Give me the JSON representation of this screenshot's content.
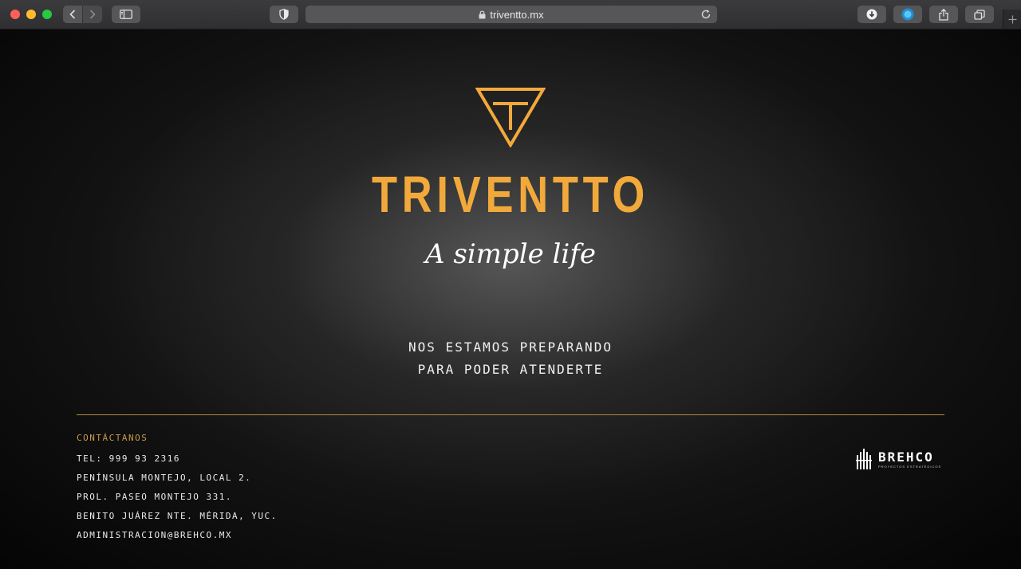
{
  "browser": {
    "url": "triventto.mx",
    "icons": [
      "back-chevron-icon",
      "forward-chevron-icon",
      "sidebar-icon",
      "shield-icon",
      "lock-icon",
      "reload-icon",
      "download-icon",
      "extension-icon",
      "share-icon",
      "tabs-icon",
      "plus-icon"
    ]
  },
  "hero": {
    "brand": "TRIVENTTO",
    "tagline": "A simple life",
    "message_line1": "NOS ESTAMOS PREPARANDO",
    "message_line2": "PARA PODER ATENDERTE"
  },
  "colors": {
    "accent": "#f2a93b",
    "contact_heading": "#c79a4a",
    "divider": "#b48a3c"
  },
  "contact": {
    "heading": "CONTÁCTANOS",
    "lines": [
      "TEL: 999 93 2316",
      "PENÍNSULA MONTEJO, LOCAL 2.",
      "PROL. PASEO MONTEJO 331.",
      "BENITO JUÁREZ NTE. MÉRIDA, YUC.",
      "ADMINISTRACION@BREHCO.MX"
    ]
  },
  "partner": {
    "name": "BREHCO",
    "subtitle": "PROYECTOS ESTRATÉGICOS"
  }
}
